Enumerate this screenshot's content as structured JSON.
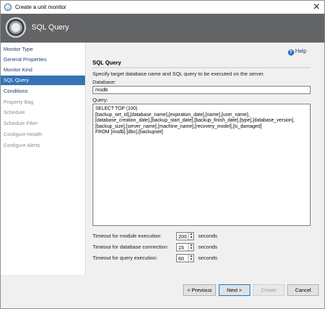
{
  "window": {
    "title": "Create a unit monitor"
  },
  "header": {
    "title": "SQL Query"
  },
  "sidebar": {
    "items": [
      {
        "label": "Monitor Type",
        "state": "normal"
      },
      {
        "label": "General Properties",
        "state": "normal"
      },
      {
        "label": "Monitor Kind",
        "state": "normal"
      },
      {
        "label": "SQL Query",
        "state": "active"
      },
      {
        "label": "Conditions",
        "state": "normal"
      },
      {
        "label": "Property Bag",
        "state": "disabled"
      },
      {
        "label": "Schedule",
        "state": "disabled"
      },
      {
        "label": "Schedule Filter",
        "state": "disabled"
      },
      {
        "label": "Configure Health",
        "state": "disabled"
      },
      {
        "label": "Configure Alerts",
        "state": "disabled"
      }
    ]
  },
  "main": {
    "help_label": "Help",
    "section_title": "SQL Query",
    "description": "Specify target database name and SQL query to be executed on the server.",
    "database_label": "Database:",
    "database_value": "msdb",
    "query_label": "Query:",
    "query_lines": [
      "SELECT TOP (100)",
      "[backup_set_id],[database_name],[expiration_date],[name],[user_name],",
      "[database_creation_date],[backup_start_date],[backup_finish_date],[type],[database_version],",
      "[backup_size],[server_name],[machine_name],[recovery_model],[is_damaged]",
      "FROM [msdb].[dbo].[backupset]"
    ],
    "timeouts": [
      {
        "label": "Timeout for module execution:",
        "value": "200",
        "unit": "seconds"
      },
      {
        "label": "Timeout for database connection:",
        "value": "15",
        "unit": "seconds"
      },
      {
        "label": "Timeout for query execution:",
        "value": "60",
        "unit": "seconds"
      }
    ]
  },
  "footer": {
    "previous_label": "< Previous",
    "next_label": "Next >",
    "create_label": "Create",
    "cancel_label": "Cancel"
  },
  "colors": {
    "header_bg": "#636466",
    "active_nav": "#3772b5",
    "nav_link": "#1b3d6b"
  }
}
